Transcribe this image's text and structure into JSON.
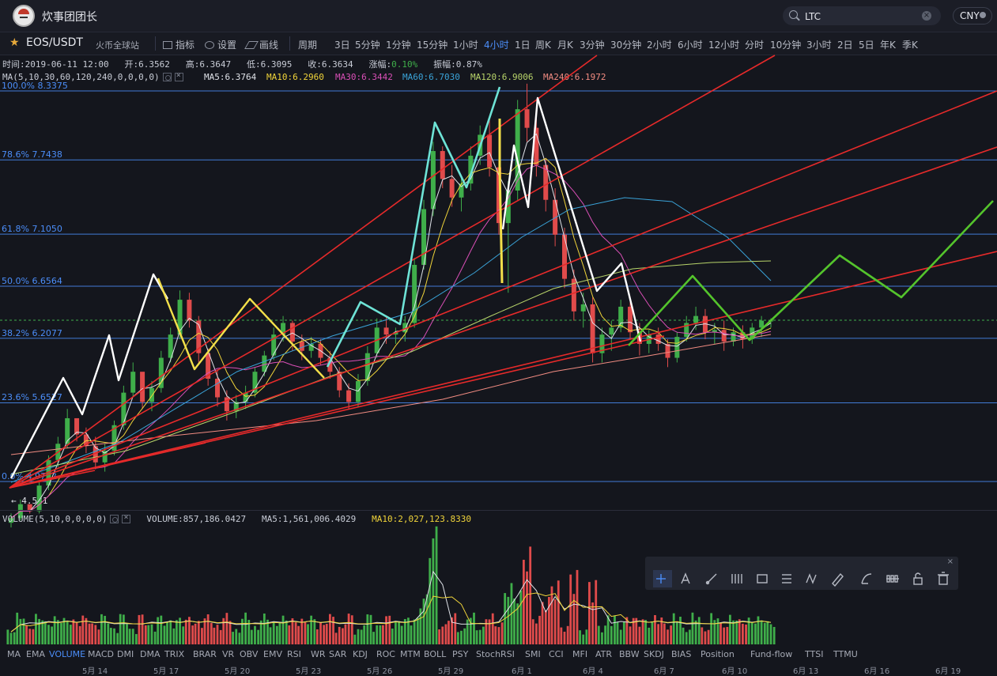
{
  "user": {
    "name": "炊事团团长"
  },
  "search": {
    "value": "LTC"
  },
  "currency": {
    "label": "CNY"
  },
  "pair": {
    "symbol": "EOS/USDT",
    "exchange": "火币全球站"
  },
  "toolbar": {
    "indicators": "指标",
    "settings": "设置",
    "draw": "画线"
  },
  "periods": [
    "周期",
    "3日",
    "5分钟",
    "1分钟",
    "15分钟",
    "1小时",
    "4小时",
    "1日",
    "周K",
    "月K",
    "3分钟",
    "30分钟",
    "2小时",
    "6小时",
    "12小时",
    "分时",
    "10分钟",
    "3小时",
    "2日",
    "5日",
    "年K",
    "季K"
  ],
  "active_period": "4小时",
  "ohlc": {
    "time_label": "时间:",
    "time": "2019-06-11 12:00",
    "open_label": "开:",
    "open": "6.3562",
    "high_label": "高:",
    "high": "6.3647",
    "low_label": "低:",
    "low": "6.3095",
    "close_label": "收:",
    "close": "6.3634",
    "change_label": "涨幅:",
    "change": "0.10%",
    "amp_label": "振幅:",
    "amp": "0.87%"
  },
  "ma_legend": {
    "title": "MA(5,10,30,60,120,240,0,0,0,0)",
    "items": [
      {
        "label": "MA5:6.3764",
        "color": "#dfe2e8"
      },
      {
        "label": "MA10:6.2960",
        "color": "#f0d43a"
      },
      {
        "label": "MA30:6.3442",
        "color": "#d94fb6"
      },
      {
        "label": "MA60:6.7030",
        "color": "#3aa3d8"
      },
      {
        "label": "MA120:6.9006",
        "color": "#b8d46a"
      },
      {
        "label": "MA240:6.1972",
        "color": "#f28c82"
      }
    ]
  },
  "fib_levels": [
    {
      "label": "100.0% 8.3375",
      "price": 8.3375
    },
    {
      "label": "78.6% 7.7438",
      "price": 7.7438
    },
    {
      "label": "61.8% 7.1050",
      "price": 7.105
    },
    {
      "label": "50.0% 6.6564",
      "price": 6.6564
    },
    {
      "label": "38.2% 6.2077",
      "price": 6.2077
    },
    {
      "label": "23.6% 5.6527",
      "price": 5.6527
    },
    {
      "label": "0.0% 4.9752",
      "price": 4.9752
    }
  ],
  "low_marker": "← 4.581",
  "volume_legend": {
    "title": "VOLUME(5,10,0,0,0,0)",
    "volume": "VOLUME:857,186.0427",
    "ma5": "MA5:1,561,006.4029",
    "ma10": "MA10:2,027,123.8330"
  },
  "indicators": [
    "MA",
    "EMA",
    "VOLUME",
    "MACD",
    "DMI",
    "DMA",
    "TRIX",
    "BRAR",
    "VR",
    "OBV",
    "EMV",
    "RSI",
    "WR",
    "SAR",
    "KDJ",
    "ROC",
    "MTM",
    "BOLL",
    "PSY",
    "StochRSI",
    "SMI",
    "CCI",
    "MFI",
    "ATR",
    "BBW",
    "SKDJ",
    "BIAS",
    "Position",
    "Fund-flow",
    "TTSI",
    "TTMU"
  ],
  "active_indicator": "VOLUME",
  "date_labels": [
    "5月 14",
    "5月 17",
    "5月 20",
    "5月 23",
    "5月 26",
    "5月 29",
    "6月 1",
    "6月 4",
    "6月 7",
    "6月 10",
    "6月 13",
    "6月 16",
    "6月 19"
  ],
  "drawing_tools": [
    "crosshair-icon",
    "text-icon",
    "line-icon",
    "channel-icon",
    "rectangle-icon",
    "fib-icon",
    "wave-icon",
    "ruler-icon",
    "brush-icon",
    "pattern-icon",
    "lock-icon",
    "trash-icon"
  ],
  "colors": {
    "up": "#3fae4a",
    "down": "#e04b4b",
    "fib": "#4b8df8",
    "trend": "#e62a2a",
    "accent": "#4b8df8"
  },
  "chart_data": {
    "type": "candlestick",
    "price_range": [
      4.5,
      8.6
    ],
    "candles": [
      [
        4.62,
        4.7,
        4.58,
        4.66
      ],
      [
        4.66,
        4.82,
        4.64,
        4.78
      ],
      [
        4.78,
        4.76,
        4.7,
        4.72
      ],
      [
        4.72,
        4.98,
        4.7,
        4.94
      ],
      [
        4.94,
        5.2,
        4.9,
        5.16
      ],
      [
        5.16,
        5.36,
        5.1,
        5.3
      ],
      [
        5.3,
        5.6,
        5.26,
        5.52
      ],
      [
        5.52,
        5.5,
        5.32,
        5.38
      ],
      [
        5.38,
        5.44,
        5.22,
        5.28
      ],
      [
        5.28,
        5.36,
        5.08,
        5.14
      ],
      [
        5.14,
        5.3,
        5.06,
        5.24
      ],
      [
        5.24,
        5.5,
        5.2,
        5.46
      ],
      [
        5.46,
        5.8,
        5.42,
        5.74
      ],
      [
        5.74,
        6.0,
        5.7,
        5.92
      ],
      [
        5.92,
        5.9,
        5.6,
        5.66
      ],
      [
        5.66,
        5.84,
        5.58,
        5.78
      ],
      [
        5.78,
        6.1,
        5.74,
        6.04
      ],
      [
        6.04,
        6.3,
        6.0,
        6.24
      ],
      [
        6.24,
        6.62,
        6.2,
        6.54
      ],
      [
        6.54,
        6.6,
        6.3,
        6.36
      ],
      [
        6.36,
        6.4,
        6.0,
        6.08
      ],
      [
        6.08,
        6.12,
        5.8,
        5.86
      ],
      [
        5.86,
        5.94,
        5.62,
        5.7
      ],
      [
        5.7,
        5.76,
        5.5,
        5.58
      ],
      [
        5.58,
        5.72,
        5.52,
        5.66
      ],
      [
        5.66,
        5.8,
        5.6,
        5.74
      ],
      [
        5.74,
        5.96,
        5.7,
        5.92
      ],
      [
        5.92,
        6.1,
        5.88,
        6.06
      ],
      [
        6.06,
        6.3,
        6.02,
        6.24
      ],
      [
        6.24,
        6.4,
        6.18,
        6.34
      ],
      [
        6.34,
        6.36,
        6.1,
        6.18
      ],
      [
        6.18,
        6.24,
        6.02,
        6.1
      ],
      [
        6.1,
        6.22,
        6.04,
        6.16
      ],
      [
        6.16,
        6.2,
        5.98,
        6.04
      ],
      [
        6.04,
        6.1,
        5.86,
        5.92
      ],
      [
        5.92,
        5.96,
        5.7,
        5.76
      ],
      [
        5.76,
        5.82,
        5.6,
        5.66
      ],
      [
        5.66,
        5.9,
        5.62,
        5.84
      ],
      [
        5.84,
        6.14,
        5.8,
        6.08
      ],
      [
        6.08,
        6.38,
        6.04,
        6.3
      ],
      [
        6.3,
        6.4,
        6.16,
        6.24
      ],
      [
        6.24,
        6.3,
        6.16,
        6.26
      ],
      [
        6.26,
        6.4,
        6.18,
        6.34
      ],
      [
        6.34,
        6.9,
        6.3,
        6.84
      ],
      [
        6.84,
        7.4,
        6.8,
        7.32
      ],
      [
        7.32,
        7.9,
        7.26,
        7.82
      ],
      [
        7.82,
        7.86,
        7.5,
        7.58
      ],
      [
        7.58,
        7.7,
        7.34,
        7.42
      ],
      [
        7.42,
        7.6,
        7.3,
        7.54
      ],
      [
        7.54,
        7.86,
        7.48,
        7.78
      ],
      [
        7.78,
        8.04,
        7.7,
        7.96
      ],
      [
        7.96,
        8.1,
        7.6,
        7.68
      ],
      [
        7.68,
        7.74,
        7.1,
        7.2
      ],
      [
        7.2,
        7.56,
        6.6,
        7.48
      ],
      [
        7.48,
        8.26,
        7.4,
        8.18
      ],
      [
        8.18,
        8.4,
        7.9,
        8.02
      ],
      [
        8.02,
        8.1,
        7.6,
        7.7
      ],
      [
        7.7,
        7.76,
        7.3,
        7.4
      ],
      [
        7.4,
        7.5,
        7.0,
        7.1
      ],
      [
        7.1,
        7.16,
        6.64,
        6.72
      ],
      [
        6.72,
        6.8,
        6.36,
        6.44
      ],
      [
        6.44,
        6.6,
        6.3,
        6.5
      ],
      [
        6.5,
        6.56,
        6.0,
        6.08
      ],
      [
        6.08,
        6.3,
        6.0,
        6.24
      ],
      [
        6.24,
        6.36,
        6.1,
        6.3
      ],
      [
        6.3,
        6.54,
        6.26,
        6.48
      ],
      [
        6.48,
        6.52,
        6.2,
        6.26
      ],
      [
        6.26,
        6.34,
        6.06,
        6.16
      ],
      [
        6.16,
        6.28,
        6.08,
        6.24
      ],
      [
        6.24,
        6.3,
        6.1,
        6.16
      ],
      [
        6.16,
        6.2,
        5.96,
        6.04
      ],
      [
        6.04,
        6.26,
        6.0,
        6.22
      ],
      [
        6.22,
        6.4,
        6.18,
        6.34
      ],
      [
        6.34,
        6.48,
        6.28,
        6.4
      ],
      [
        6.4,
        6.46,
        6.2,
        6.26
      ],
      [
        6.26,
        6.34,
        6.16,
        6.28
      ],
      [
        6.28,
        6.36,
        6.1,
        6.18
      ],
      [
        6.18,
        6.3,
        6.14,
        6.26
      ],
      [
        6.26,
        6.32,
        6.12,
        6.2
      ],
      [
        6.2,
        6.34,
        6.16,
        6.3
      ],
      [
        6.3,
        6.4,
        6.22,
        6.36
      ],
      [
        6.36,
        6.38,
        6.3,
        6.36
      ]
    ],
    "volume_max": 6000000
  }
}
